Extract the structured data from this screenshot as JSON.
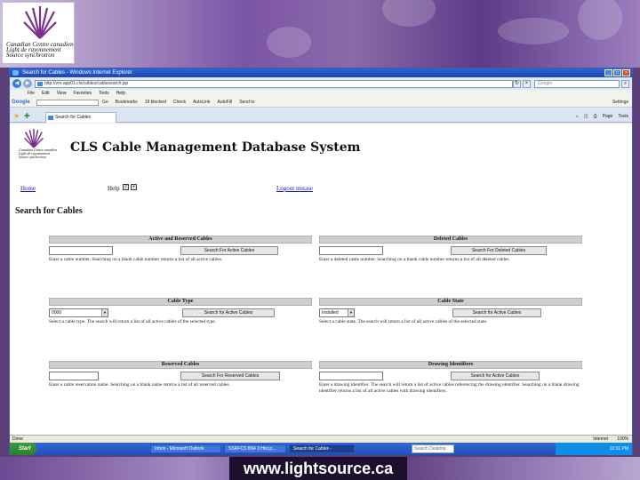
{
  "slide": {
    "logo_lines": [
      "Canadian  Centre canadien",
      "Light   de rayonnement",
      "Source  synchrotron"
    ],
    "footer_url": "www.lightsource.ca"
  },
  "browser": {
    "window_title": "Search for Cables - Windows Internet Explorer",
    "address": "http://vm-app01.cls/cables/cablesearch.jsp",
    "search_placeholder": "Google",
    "menu": [
      "File",
      "Edit",
      "View",
      "Favorites",
      "Tools",
      "Help"
    ],
    "google_label": "Google",
    "google_toolbar_items": [
      "Go",
      "Bookmarks",
      "19 blocked",
      "Check",
      "AutoLink",
      "AutoFill",
      "Send to"
    ],
    "google_settings": "Settings",
    "tab_label": "Search for Cables",
    "commands": [
      "Page",
      "Tools"
    ],
    "status_left": "Done",
    "status_zone": "Internet",
    "status_zoom": "100%"
  },
  "taskbar": {
    "start": "Start",
    "items": [
      "Inbox - Microsoft Outlook",
      "SSRFCS 8N4 3 Hist.p...",
      "Search for Cables -"
    ],
    "search_placeholder": "Search Desktop",
    "clock": "10:31 PM"
  },
  "page": {
    "logo_lines": [
      "Canadian Centre canadien",
      "Light   de rayonnement",
      "Source synchrotron"
    ],
    "title": "CLS Cable Management Database System",
    "home_link": "Home",
    "help_label": "Help",
    "logout_link": "Logout mstase",
    "section_title": "Search for Cables"
  },
  "panels": {
    "active_reserved": {
      "header": "Active and Reserved Cables",
      "button": "Search For Active Cables",
      "description": "Enter a cable number. Searching on a blank cable number returns a list of all active cables."
    },
    "deleted": {
      "header": "Deleted Cables",
      "button": "Search For Deleted Cables",
      "description": "Enter a deleted cable number. Searching on a blank cable number returns a list of all deleted cables."
    },
    "cable_type": {
      "header": "Cable Type",
      "select_value": "0000",
      "button": "Search for Active Cables",
      "description": "Select a cable type. The search will return a list of all active cables of the selected type."
    },
    "cable_state": {
      "header": "Cable State",
      "select_value": "Installed",
      "button": "Search for Active Cables",
      "description": "Select a cable state. The search will return a list of all active cables of the selected state."
    },
    "reserved": {
      "header": "Reserved Cables",
      "button": "Search For Reserved Cables",
      "description": "Enter a cable reservation name. Searching on a blank name returns a list of all reserved cables."
    },
    "drawing": {
      "header": "Drawing Identifiers",
      "button": "Search for Active Cables",
      "description": "Enter a drawing identifier. The search will return a list of active cables referencing the drawing identifier. Searching on a blank drawing identifier returns a list of all active cables with drawing identifiers."
    }
  }
}
